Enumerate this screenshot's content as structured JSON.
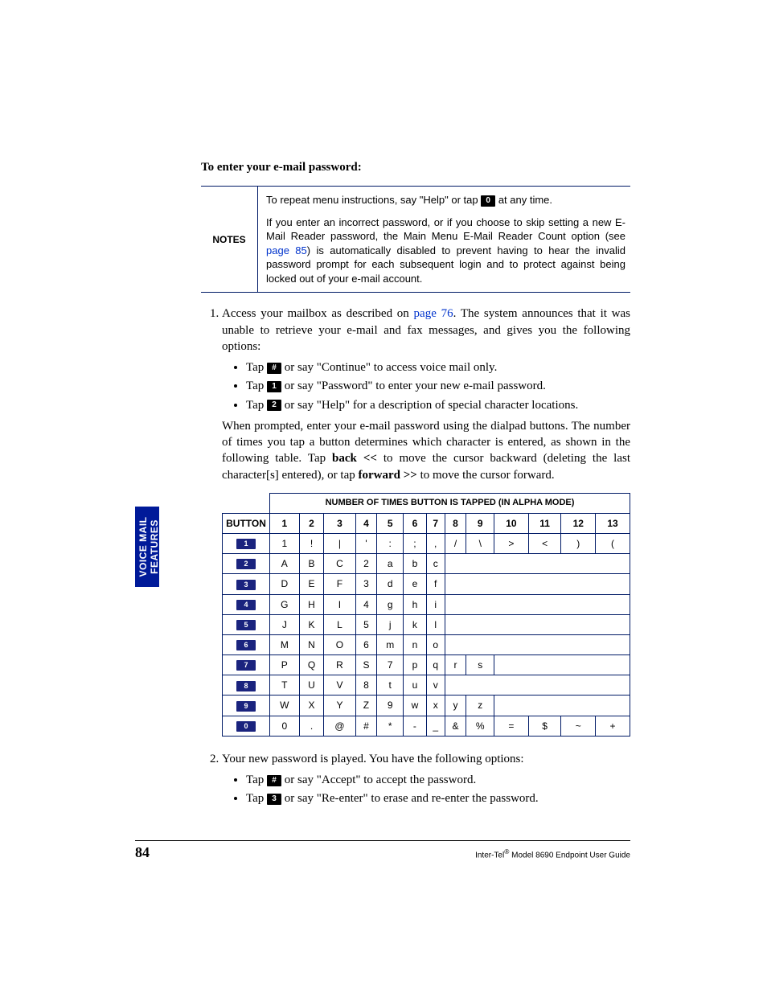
{
  "heading": "To enter your e-mail password:",
  "notes": {
    "label": "NOTES",
    "p1a": "To repeat menu instructions, say \"Help\" or tap ",
    "p1key": "0",
    "p1b": " at any time.",
    "p2a": "If you enter an incorrect password, or if you choose to skip setting a new E-Mail Reader password, the Main Menu E-Mail Reader Count option (see ",
    "p2link": "page 85",
    "p2b": ") is automatically disabled to prevent having to hear the invalid password prompt for each subsequent login and to protect against being locked out of your e-mail account."
  },
  "step1": {
    "intro_a": "Access your mailbox as described on ",
    "intro_link": "page 76",
    "intro_b": ". The system announces that it was unable to retrieve your e-mail and fax messages, and gives you the following options:",
    "b1_pre": "Tap ",
    "b1_key": "#",
    "b1_post": " or say \"Continue\" to access voice mail only.",
    "b2_pre": "Tap ",
    "b2_key": "1",
    "b2_post": " or say \"Password\" to enter your new e-mail password.",
    "b3_pre": "Tap ",
    "b3_key": "2",
    "b3_post": " or say \"Help\" for a description of special character locations.",
    "para_a": "When prompted, enter your e-mail password using the dialpad buttons. The number of times you tap a button determines which character is entered, as shown in the following table. Tap ",
    "para_back": "back <<",
    "para_mid": " to move the cursor backward (deleting the last character[s] entered), or tap ",
    "para_fwd": "forward >>",
    "para_end": " to move the cursor forward."
  },
  "table": {
    "top_header": "NUMBER OF TIMES BUTTON IS TAPPED (IN ALPHA MODE)",
    "button_header": "BUTTON",
    "col_headers": [
      "1",
      "2",
      "3",
      "4",
      "5",
      "6",
      "7",
      "8",
      "9",
      "10",
      "11",
      "12",
      "13"
    ],
    "rows": [
      {
        "btn": "1",
        "cells": [
          "1",
          "!",
          "|",
          "'",
          ":",
          ";",
          ",",
          "/",
          "\\",
          ">",
          "<",
          ")",
          "("
        ]
      },
      {
        "btn": "2",
        "cells": [
          "A",
          "B",
          "C",
          "2",
          "a",
          "b",
          "c",
          "",
          "",
          "",
          "",
          "",
          ""
        ]
      },
      {
        "btn": "3",
        "cells": [
          "D",
          "E",
          "F",
          "3",
          "d",
          "e",
          "f",
          "",
          "",
          "",
          "",
          "",
          ""
        ]
      },
      {
        "btn": "4",
        "cells": [
          "G",
          "H",
          "I",
          "4",
          "g",
          "h",
          "i",
          "",
          "",
          "",
          "",
          "",
          ""
        ]
      },
      {
        "btn": "5",
        "cells": [
          "J",
          "K",
          "L",
          "5",
          "j",
          "k",
          "l",
          "",
          "",
          "",
          "",
          "",
          ""
        ]
      },
      {
        "btn": "6",
        "cells": [
          "M",
          "N",
          "O",
          "6",
          "m",
          "n",
          "o",
          "",
          "",
          "",
          "",
          "",
          ""
        ]
      },
      {
        "btn": "7",
        "cells": [
          "P",
          "Q",
          "R",
          "S",
          "7",
          "p",
          "q",
          "r",
          "s",
          "",
          "",
          "",
          ""
        ]
      },
      {
        "btn": "8",
        "cells": [
          "T",
          "U",
          "V",
          "8",
          "t",
          "u",
          "v",
          "",
          "",
          "",
          "",
          "",
          ""
        ]
      },
      {
        "btn": "9",
        "cells": [
          "W",
          "X",
          "Y",
          "Z",
          "9",
          "w",
          "x",
          "y",
          "z",
          "",
          "",
          "",
          ""
        ]
      },
      {
        "btn": "0",
        "cells": [
          "0",
          ".",
          "@",
          "#",
          "*",
          "-",
          "_",
          "&",
          "%",
          "=",
          "$",
          "~",
          "+"
        ]
      }
    ]
  },
  "step2": {
    "intro": "Your new password is played. You have the following options:",
    "b1_pre": "Tap ",
    "b1_key": "#",
    "b1_post": " or say \"Accept\" to accept the password.",
    "b2_pre": "Tap ",
    "b2_key": "3",
    "b2_post": " or say \"Re-enter\" to erase and re-enter the password."
  },
  "side_tab": {
    "line1": "VOICE MAIL",
    "line2": "FEATURES"
  },
  "footer": {
    "page_number": "84",
    "guide_pre": "Inter-Tel",
    "reg": "®",
    "guide_post": " Model 8690 Endpoint User Guide"
  }
}
